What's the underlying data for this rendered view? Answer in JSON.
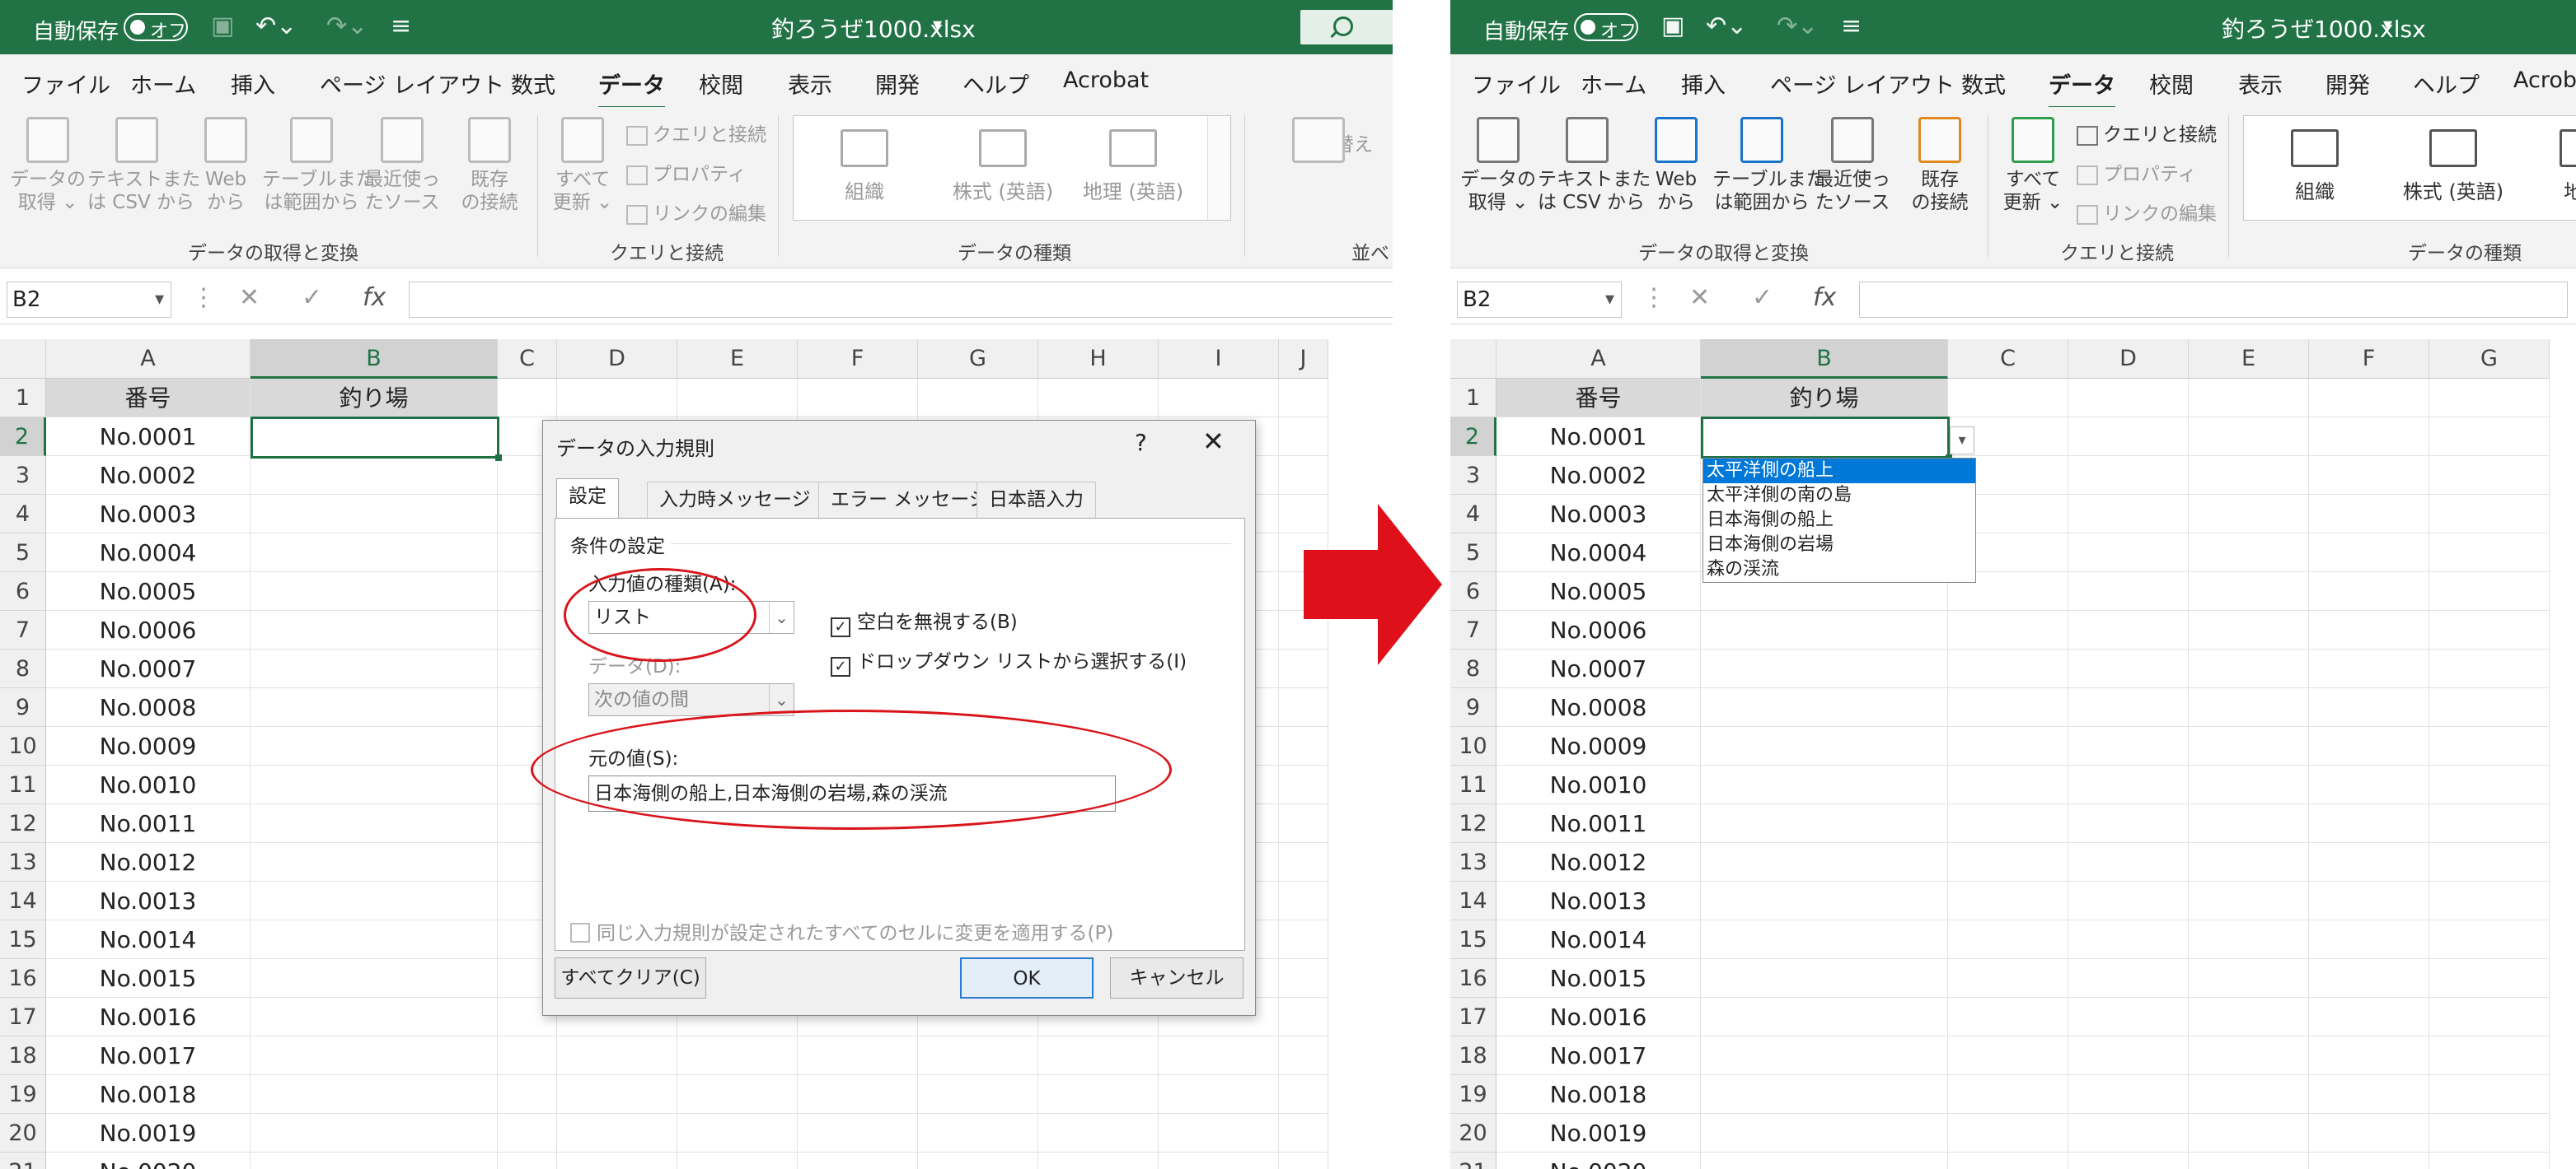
{
  "left": {
    "autosave_label": "自動保存",
    "autosave_state": "オフ",
    "file_title": "釣ろうぜ1000.xlsx",
    "tabs": [
      "ファイル",
      "ホーム",
      "挿入",
      "ページ レイアウト",
      "数式",
      "データ",
      "校閲",
      "表示",
      "開発",
      "ヘルプ",
      "Acrobat"
    ],
    "ribbon": {
      "get_data": [
        "データの",
        "取得 ⌄"
      ],
      "text_csv": [
        "テキストまた",
        "は CSV から"
      ],
      "web": [
        "Web",
        "から"
      ],
      "table_range": [
        "テーブルまた",
        "は範囲から"
      ],
      "recent": [
        "最近使っ",
        "たソース"
      ],
      "existing": [
        "既存",
        "の接続"
      ],
      "refresh_all": [
        "すべて",
        "更新 ⌄"
      ],
      "queries_conn": "クエリと接続",
      "properties": "プロパティ",
      "edit_links": "リンクの編集",
      "org": "組織",
      "stocks": "株式 (英語)",
      "geo": "地理 (英語)",
      "sort": "並べ替え",
      "group_getdata": "データの取得と変換",
      "group_queries": "クエリと接続",
      "group_datatypes": "データの種類",
      "group_sort": "並べ"
    },
    "namebox": "B2",
    "fx": "fx",
    "cols": [
      "A",
      "B",
      "C",
      "D",
      "E",
      "F",
      "G",
      "H",
      "I",
      "J"
    ],
    "header_a": "番号",
    "header_b": "釣り場",
    "row_labels": [
      "No.0001",
      "No.0002",
      "No.0003",
      "No.0004",
      "No.0005",
      "No.0006",
      "No.0007",
      "No.0008",
      "No.0009",
      "No.0010",
      "No.0011",
      "No.0012",
      "No.0013",
      "No.0014",
      "No.0015",
      "No.0016",
      "No.0017",
      "No.0018",
      "No.0019",
      "No.0020"
    ],
    "dialog": {
      "title": "データの入力規則",
      "help": "?",
      "close": "✕",
      "tabs": [
        "設定",
        "入力時メッセージ",
        "エラー メッセージ",
        "日本語入力"
      ],
      "section": "条件の設定",
      "allow_label": "入力値の種類(A):",
      "allow_value": "リスト",
      "ignore_blank": "空白を無視する(B)",
      "dropdown": "ドロップダウン リストから選択する(I)",
      "data_label": "データ(D):",
      "data_value": "次の値の間",
      "source_label": "元の値(S):",
      "source_value": "日本海側の船上,日本海側の岩場,森の渓流",
      "apply_all": "同じ入力規則が設定されたすべてのセルに変更を適用する(P)",
      "clear_all": "すべてクリア(C)",
      "ok": "OK",
      "cancel": "キャンセル"
    }
  },
  "right": {
    "autosave_label": "自動保存",
    "autosave_state": "オフ",
    "file_title": "釣ろうぜ1000.xlsx",
    "tabs": [
      "ファイル",
      "ホーム",
      "挿入",
      "ページ レイアウト",
      "数式",
      "データ",
      "校閲",
      "表示",
      "開発",
      "ヘルプ",
      "Acrob"
    ],
    "ribbon": {
      "get_data": [
        "データの",
        "取得 ⌄"
      ],
      "text_csv": [
        "テキストまた",
        "は CSV から"
      ],
      "web": [
        "Web",
        "から"
      ],
      "table_range": [
        "テーブルまた",
        "は範囲から"
      ],
      "recent": [
        "最近使っ",
        "たソース"
      ],
      "existing": [
        "既存",
        "の接続"
      ],
      "refresh_all": [
        "すべて",
        "更新 ⌄"
      ],
      "queries_conn": "クエリと接続",
      "properties": "プロパティ",
      "edit_links": "リンクの編集",
      "org": "組織",
      "stocks": "株式 (英語)",
      "geo": "地理",
      "group_getdata": "データの取得と変換",
      "group_queries": "クエリと接続",
      "group_datatypes": "データの種類"
    },
    "namebox": "B2",
    "fx": "fx",
    "cols": [
      "A",
      "B",
      "C",
      "D",
      "E",
      "F",
      "G"
    ],
    "header_a": "番号",
    "header_b": "釣り場",
    "row_labels": [
      "No.0001",
      "No.0002",
      "No.0003",
      "No.0004",
      "No.0005",
      "No.0006",
      "No.0007",
      "No.0008",
      "No.0009",
      "No.0010",
      "No.0011",
      "No.0012",
      "No.0013",
      "No.0014",
      "No.0015",
      "No.0016",
      "No.0017",
      "No.0018",
      "No.0019",
      "No.0020"
    ],
    "dropdown_items": [
      "太平洋側の船上",
      "太平洋側の南の島",
      "日本海側の船上",
      "日本海側の岩場",
      "森の渓流"
    ]
  },
  "colors": {
    "excel_green": "#217346",
    "annotation_red": "#d9141b",
    "selection_blue": "#0078d7"
  }
}
